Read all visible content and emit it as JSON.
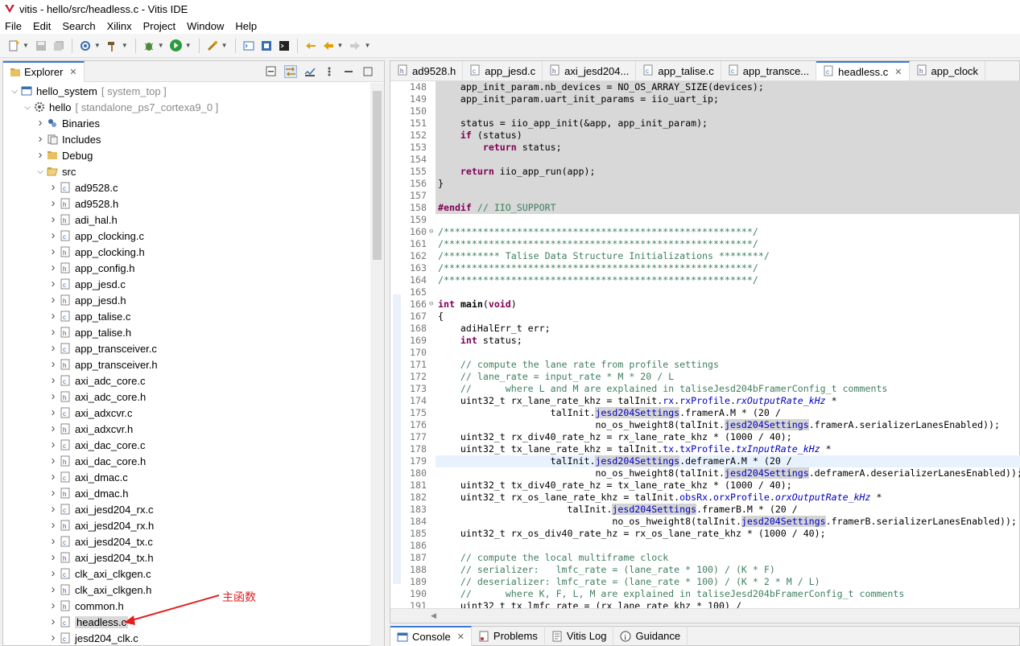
{
  "window": {
    "title": "vitis - hello/src/headless.c - Vitis IDE"
  },
  "menu": [
    "File",
    "Edit",
    "Search",
    "Xilinx",
    "Project",
    "Window",
    "Help"
  ],
  "explorer": {
    "tab_label": "Explorer",
    "tree": [
      {
        "label": "hello_system",
        "suffix": "[ system_top ]",
        "depth": 0,
        "twisty": "open",
        "icon": "system-icon"
      },
      {
        "label": "hello",
        "suffix": "[ standalone_ps7_cortexa9_0 ]",
        "depth": 1,
        "twisty": "open",
        "icon": "project-icon"
      },
      {
        "label": "Binaries",
        "depth": 2,
        "twisty": "closed",
        "icon": "binaries-icon"
      },
      {
        "label": "Includes",
        "depth": 2,
        "twisty": "closed",
        "icon": "includes-icon"
      },
      {
        "label": "Debug",
        "depth": 2,
        "twisty": "closed",
        "icon": "folder-icon"
      },
      {
        "label": "src",
        "depth": 2,
        "twisty": "open",
        "icon": "folder-open-icon"
      },
      {
        "label": "ad9528.c",
        "depth": 3,
        "twisty": "closed",
        "icon": "c-file-icon"
      },
      {
        "label": "ad9528.h",
        "depth": 3,
        "twisty": "closed",
        "icon": "h-file-icon"
      },
      {
        "label": "adi_hal.h",
        "depth": 3,
        "twisty": "closed",
        "icon": "h-file-icon"
      },
      {
        "label": "app_clocking.c",
        "depth": 3,
        "twisty": "closed",
        "icon": "c-file-icon"
      },
      {
        "label": "app_clocking.h",
        "depth": 3,
        "twisty": "closed",
        "icon": "h-file-icon"
      },
      {
        "label": "app_config.h",
        "depth": 3,
        "twisty": "closed",
        "icon": "h-file-icon"
      },
      {
        "label": "app_jesd.c",
        "depth": 3,
        "twisty": "closed",
        "icon": "c-file-icon"
      },
      {
        "label": "app_jesd.h",
        "depth": 3,
        "twisty": "closed",
        "icon": "h-file-icon"
      },
      {
        "label": "app_talise.c",
        "depth": 3,
        "twisty": "closed",
        "icon": "c-file-icon"
      },
      {
        "label": "app_talise.h",
        "depth": 3,
        "twisty": "closed",
        "icon": "h-file-icon"
      },
      {
        "label": "app_transceiver.c",
        "depth": 3,
        "twisty": "closed",
        "icon": "c-file-icon"
      },
      {
        "label": "app_transceiver.h",
        "depth": 3,
        "twisty": "closed",
        "icon": "h-file-icon"
      },
      {
        "label": "axi_adc_core.c",
        "depth": 3,
        "twisty": "closed",
        "icon": "c-file-icon"
      },
      {
        "label": "axi_adc_core.h",
        "depth": 3,
        "twisty": "closed",
        "icon": "h-file-icon"
      },
      {
        "label": "axi_adxcvr.c",
        "depth": 3,
        "twisty": "closed",
        "icon": "c-file-icon"
      },
      {
        "label": "axi_adxcvr.h",
        "depth": 3,
        "twisty": "closed",
        "icon": "h-file-icon"
      },
      {
        "label": "axi_dac_core.c",
        "depth": 3,
        "twisty": "closed",
        "icon": "c-file-icon"
      },
      {
        "label": "axi_dac_core.h",
        "depth": 3,
        "twisty": "closed",
        "icon": "h-file-icon"
      },
      {
        "label": "axi_dmac.c",
        "depth": 3,
        "twisty": "closed",
        "icon": "c-file-icon"
      },
      {
        "label": "axi_dmac.h",
        "depth": 3,
        "twisty": "closed",
        "icon": "h-file-icon"
      },
      {
        "label": "axi_jesd204_rx.c",
        "depth": 3,
        "twisty": "closed",
        "icon": "c-file-icon"
      },
      {
        "label": "axi_jesd204_rx.h",
        "depth": 3,
        "twisty": "closed",
        "icon": "h-file-icon"
      },
      {
        "label": "axi_jesd204_tx.c",
        "depth": 3,
        "twisty": "closed",
        "icon": "c-file-icon"
      },
      {
        "label": "axi_jesd204_tx.h",
        "depth": 3,
        "twisty": "closed",
        "icon": "h-file-icon"
      },
      {
        "label": "clk_axi_clkgen.c",
        "depth": 3,
        "twisty": "closed",
        "icon": "c-file-icon"
      },
      {
        "label": "clk_axi_clkgen.h",
        "depth": 3,
        "twisty": "closed",
        "icon": "h-file-icon"
      },
      {
        "label": "common.h",
        "depth": 3,
        "twisty": "closed",
        "icon": "h-file-icon"
      },
      {
        "label": "headless.c",
        "depth": 3,
        "twisty": "closed",
        "icon": "c-file-icon",
        "selected": true
      },
      {
        "label": "jesd204_clk.c",
        "depth": 3,
        "twisty": "closed",
        "icon": "c-file-icon"
      }
    ],
    "annotation": "主函数"
  },
  "editor": {
    "tabs": [
      {
        "label": "ad9528.h",
        "icon": "h-file-icon"
      },
      {
        "label": "app_jesd.c",
        "icon": "c-file-icon"
      },
      {
        "label": "axi_jesd204...",
        "icon": "h-file-icon"
      },
      {
        "label": "app_talise.c",
        "icon": "c-file-icon"
      },
      {
        "label": "app_transce...",
        "icon": "c-file-icon"
      },
      {
        "label": "headless.c",
        "icon": "c-file-icon",
        "active": true
      },
      {
        "label": "app_clock",
        "icon": "h-file-icon"
      }
    ],
    "lines": [
      {
        "n": "148",
        "t": "    app_init_param.nb_devices = NO_OS_ARRAY_SIZE(devices);",
        "gray": true
      },
      {
        "n": "149",
        "t": "    app_init_param.uart_init_params = iio_uart_ip;",
        "gray": true
      },
      {
        "n": "150",
        "t": "",
        "gray": true
      },
      {
        "n": "151",
        "t": "    status = iio_app_init(&app, app_init_param);",
        "gray": true
      },
      {
        "n": "152",
        "t": "    if (status)",
        "gray": true
      },
      {
        "n": "153",
        "t": "        return status;",
        "gray": true
      },
      {
        "n": "154",
        "t": "",
        "gray": true
      },
      {
        "n": "155",
        "t": "    return iio_app_run(app);",
        "gray": true
      },
      {
        "n": "156",
        "t": "}",
        "gray": true
      },
      {
        "n": "157",
        "t": "",
        "gray": true
      },
      {
        "n": "158",
        "t": "#endif // IIO_SUPPORT",
        "gray": true
      },
      {
        "n": "159",
        "t": ""
      },
      {
        "n": "160",
        "t": "/*******************************************************/",
        "fold": true
      },
      {
        "n": "161",
        "t": "/*******************************************************/"
      },
      {
        "n": "162",
        "t": "/********** Talise Data Structure Initializations ********/"
      },
      {
        "n": "163",
        "t": "/*******************************************************/"
      },
      {
        "n": "164",
        "t": "/*******************************************************/"
      },
      {
        "n": "165",
        "t": ""
      },
      {
        "n": "166",
        "t": "int main(void)",
        "fold": true
      },
      {
        "n": "167",
        "t": "{"
      },
      {
        "n": "168",
        "t": "    adiHalErr_t err;"
      },
      {
        "n": "169",
        "t": "    int status;"
      },
      {
        "n": "170",
        "t": ""
      },
      {
        "n": "171",
        "t": "    // compute the lane rate from profile settings"
      },
      {
        "n": "172",
        "t": "    // lane_rate = input_rate * M * 20 / L"
      },
      {
        "n": "173",
        "t": "    //      where L and M are explained in taliseJesd204bFramerConfig_t comments"
      },
      {
        "n": "174",
        "t": "    uint32_t rx_lane_rate_khz = talInit.rx.rxProfile.rxOutputRate_kHz *"
      },
      {
        "n": "175",
        "t": "                    talInit.jesd204Settings.framerA.M * (20 /"
      },
      {
        "n": "176",
        "t": "                            no_os_hweight8(talInit.jesd204Settings.framerA.serializerLanesEnabled));"
      },
      {
        "n": "177",
        "t": "    uint32_t rx_div40_rate_hz = rx_lane_rate_khz * (1000 / 40);"
      },
      {
        "n": "178",
        "t": "    uint32_t tx_lane_rate_khz = talInit.tx.txProfile.txInputRate_kHz *"
      },
      {
        "n": "179",
        "t": "                    talInit.jesd204Settings.deframerA.M * (20 /",
        "cur": true
      },
      {
        "n": "180",
        "t": "                            no_os_hweight8(talInit.jesd204Settings.deframerA.deserializerLanesEnabled));"
      },
      {
        "n": "181",
        "t": "    uint32_t tx_div40_rate_hz = tx_lane_rate_khz * (1000 / 40);"
      },
      {
        "n": "182",
        "t": "    uint32_t rx_os_lane_rate_khz = talInit.obsRx.orxProfile.orxOutputRate_kHz *"
      },
      {
        "n": "183",
        "t": "                       talInit.jesd204Settings.framerB.M * (20 /"
      },
      {
        "n": "184",
        "t": "                               no_os_hweight8(talInit.jesd204Settings.framerB.serializerLanesEnabled));"
      },
      {
        "n": "185",
        "t": "    uint32_t rx_os_div40_rate_hz = rx_os_lane_rate_khz * (1000 / 40);"
      },
      {
        "n": "186",
        "t": ""
      },
      {
        "n": "187",
        "t": "    // compute the local multiframe clock"
      },
      {
        "n": "188",
        "t": "    // serializer:   lmfc_rate = (lane_rate * 100) / (K * F)"
      },
      {
        "n": "189",
        "t": "    // deserializer: lmfc_rate = (lane_rate * 100) / (K * 2 * M / L)"
      },
      {
        "n": "190",
        "t": "    //      where K, F, L, M are explained in taliseJesd204bFramerConfig_t comments"
      },
      {
        "n": "191",
        "t": "    uint32_t tx_lmfc_rate = (rx_lane_rate_khz * 100) /"
      }
    ]
  },
  "bottom_tabs": [
    {
      "label": "Console",
      "icon": "console-icon",
      "active": true
    },
    {
      "label": "Problems",
      "icon": "problems-icon"
    },
    {
      "label": "Vitis Log",
      "icon": "log-icon"
    },
    {
      "label": "Guidance",
      "icon": "info-icon"
    }
  ]
}
